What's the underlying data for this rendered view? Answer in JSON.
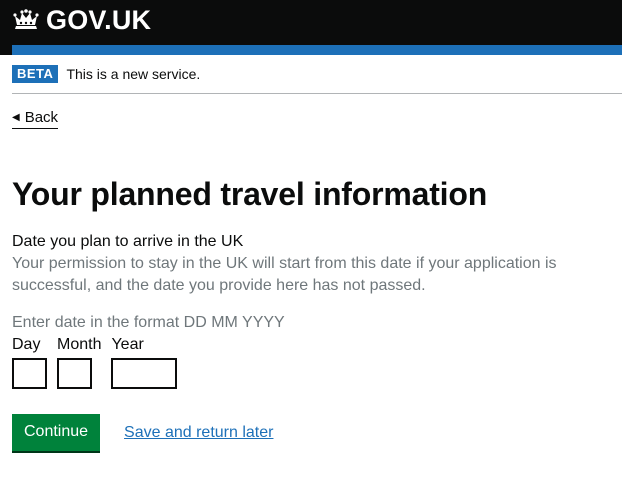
{
  "header": {
    "logo_text": "GOV.UK",
    "icon": "crown-icon",
    "colors": {
      "background": "#0b0c0c",
      "stripe": "#1d70b8"
    }
  },
  "phase_banner": {
    "tag": "BETA",
    "text": "This is a new service."
  },
  "back_link": {
    "label": "Back",
    "icon": "back-arrow-icon"
  },
  "page": {
    "title": "Your planned travel information"
  },
  "date_question": {
    "label": "Date you plan to arrive in the UK",
    "hint": "Your permission to stay in the UK will start from this date if your application is successful, and the date you provide here has not passed.",
    "format_hint": "Enter date in the format DD MM YYYY",
    "fields": {
      "day": {
        "label": "Day",
        "value": ""
      },
      "month": {
        "label": "Month",
        "value": ""
      },
      "year": {
        "label": "Year",
        "value": ""
      }
    }
  },
  "actions": {
    "continue_label": "Continue",
    "save_label": "Save and return later",
    "colors": {
      "button": "#00823b",
      "link": "#1d70b8"
    }
  }
}
